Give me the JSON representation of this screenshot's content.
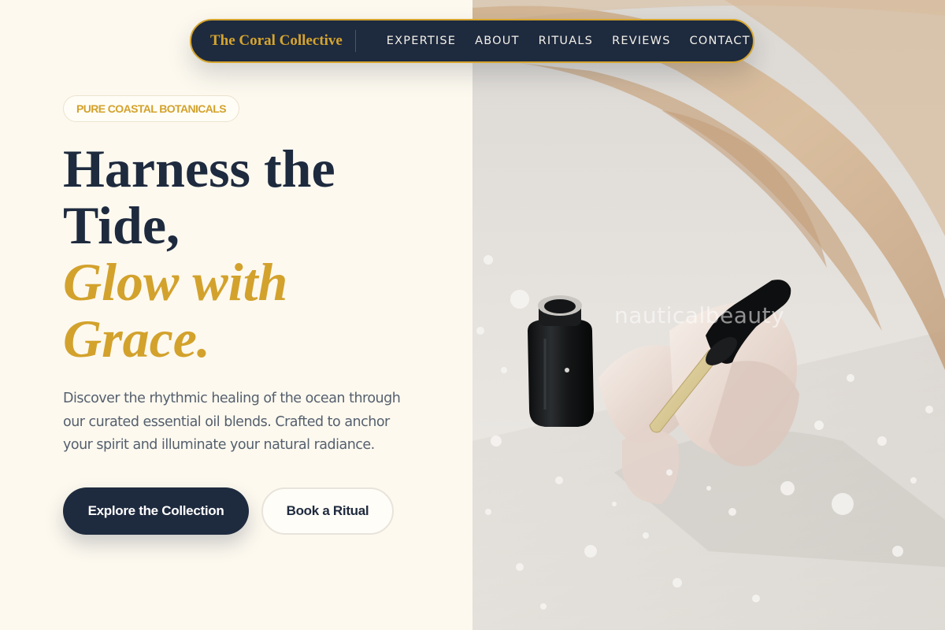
{
  "nav": {
    "brand": "The Coral Collective",
    "links": [
      "EXPERTISE",
      "ABOUT",
      "RITUALS",
      "REVIEWS",
      "CONTACT"
    ]
  },
  "hero": {
    "badge": "PURE COASTAL BOTANICALS",
    "headline_line1": "Harness the",
    "headline_line2": "Tide,",
    "headline_accent1": "Glow with",
    "headline_accent2": "Grace.",
    "lead": "Discover the rhythmic healing of the ocean through our curated essential oil blends. Crafted to anchor your spirit and illuminate your natural radiance.",
    "primary_cta": "Explore the Collection",
    "secondary_cta": "Book a Ritual"
  },
  "photo": {
    "watermark": "nauticalbeauty"
  },
  "colors": {
    "navy": "#1e2a3e",
    "gold": "#d3a22c",
    "cream": "#fdf9ef"
  }
}
